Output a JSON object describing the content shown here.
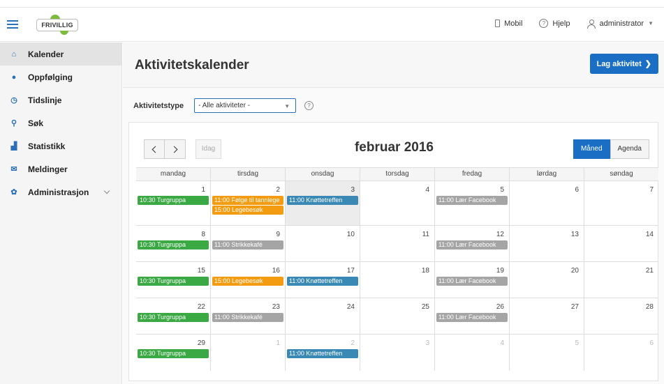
{
  "header": {
    "logo_text": "FRIVILLIG",
    "links": {
      "mobile": "Mobil",
      "help": "Hjelp",
      "user": "administrator"
    }
  },
  "sidebar": {
    "items": [
      {
        "label": "Kalender",
        "icon": "home-icon"
      },
      {
        "label": "Oppfølging",
        "icon": "group-icon"
      },
      {
        "label": "Tidslinje",
        "icon": "clock-icon"
      },
      {
        "label": "Søk",
        "icon": "search-icon"
      },
      {
        "label": "Statistikk",
        "icon": "chart-icon"
      },
      {
        "label": "Meldinger",
        "icon": "envelope-icon"
      },
      {
        "label": "Administrasjon",
        "icon": "gear-icon"
      }
    ]
  },
  "page": {
    "title": "Aktivitetskalender",
    "create_button": "Lag aktivitet"
  },
  "filter": {
    "label": "Aktivitetstype",
    "selected": "- Alle aktiviteter -"
  },
  "calendar": {
    "today_label": "Idag",
    "title": "februar 2016",
    "views": {
      "month": "Måned",
      "agenda": "Agenda"
    },
    "weekdays": [
      "mandag",
      "tirsdag",
      "onsdag",
      "torsdag",
      "fredag",
      "lørdag",
      "søndag"
    ],
    "weeks": [
      [
        {
          "day": "1",
          "events": [
            {
              "text": "10:30 Turgruppa",
              "color": "green"
            }
          ]
        },
        {
          "day": "2",
          "events": [
            {
              "text": "11:00 Følge til tannlege",
              "color": "orange"
            },
            {
              "text": "15:00 Legebesøk",
              "color": "orange"
            }
          ]
        },
        {
          "day": "3",
          "today": true,
          "events": [
            {
              "text": "11:00 Knøttetreffen",
              "color": "blue"
            }
          ]
        },
        {
          "day": "4",
          "events": []
        },
        {
          "day": "5",
          "events": [
            {
              "text": "11:00 Lær Facebook",
              "color": "gray"
            }
          ]
        },
        {
          "day": "6",
          "events": []
        },
        {
          "day": "7",
          "events": []
        }
      ],
      [
        {
          "day": "8",
          "events": [
            {
              "text": "10:30 Turgruppa",
              "color": "green"
            }
          ]
        },
        {
          "day": "9",
          "events": [
            {
              "text": "11:00 Strikkekafé",
              "color": "gray"
            }
          ]
        },
        {
          "day": "10",
          "events": []
        },
        {
          "day": "11",
          "events": []
        },
        {
          "day": "12",
          "events": [
            {
              "text": "11:00 Lær Facebook",
              "color": "gray"
            }
          ]
        },
        {
          "day": "13",
          "events": []
        },
        {
          "day": "14",
          "events": []
        }
      ],
      [
        {
          "day": "15",
          "events": [
            {
              "text": "10:30 Turgruppa",
              "color": "green"
            }
          ]
        },
        {
          "day": "16",
          "events": [
            {
              "text": "15:00 Legebesøk",
              "color": "orange"
            }
          ]
        },
        {
          "day": "17",
          "events": [
            {
              "text": "11:00 Knøttetreffen",
              "color": "blue"
            }
          ]
        },
        {
          "day": "18",
          "events": []
        },
        {
          "day": "19",
          "events": [
            {
              "text": "11:00 Lær Facebook",
              "color": "gray"
            }
          ]
        },
        {
          "day": "20",
          "events": []
        },
        {
          "day": "21",
          "events": []
        }
      ],
      [
        {
          "day": "22",
          "events": [
            {
              "text": "10:30 Turgruppa",
              "color": "green"
            }
          ]
        },
        {
          "day": "23",
          "events": [
            {
              "text": "11:00 Strikkekafé",
              "color": "gray"
            }
          ]
        },
        {
          "day": "24",
          "events": []
        },
        {
          "day": "25",
          "events": []
        },
        {
          "day": "26",
          "events": [
            {
              "text": "11:00 Lær Facebook",
              "color": "gray"
            }
          ]
        },
        {
          "day": "27",
          "events": []
        },
        {
          "day": "28",
          "events": []
        }
      ],
      [
        {
          "day": "29",
          "events": [
            {
              "text": "10:30 Turgruppa",
              "color": "green"
            }
          ]
        },
        {
          "day": "1",
          "other": true,
          "events": []
        },
        {
          "day": "2",
          "other": true,
          "events": [
            {
              "text": "11:00 Knøttetreffen",
              "color": "blue"
            }
          ]
        },
        {
          "day": "3",
          "other": true,
          "events": []
        },
        {
          "day": "4",
          "other": true,
          "events": []
        },
        {
          "day": "5",
          "other": true,
          "events": []
        },
        {
          "day": "6",
          "other": true,
          "events": []
        }
      ]
    ]
  },
  "colors": {
    "accent": "#1a6fc4",
    "green": "#3aa843",
    "orange": "#f39c12",
    "blue": "#3a89b5",
    "gray": "#a5a5a5"
  }
}
